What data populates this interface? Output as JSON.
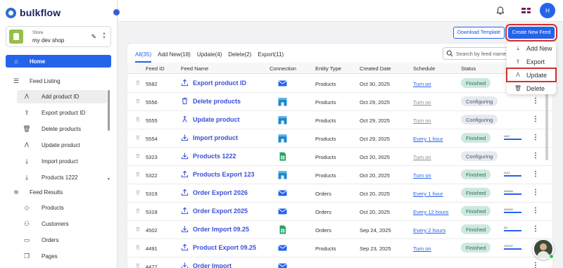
{
  "app": {
    "name": "bulkflow"
  },
  "store": {
    "label": "Store",
    "name": "my dev shop"
  },
  "sidebar": {
    "home": "Home",
    "feed_listing": "Feed Listing",
    "feed_items": [
      {
        "label": "Add product ID",
        "icon": "person-up-icon",
        "active": true
      },
      {
        "label": "Export product ID",
        "icon": "upload-icon"
      },
      {
        "label": "Delete products",
        "icon": "trash-icon"
      },
      {
        "label": "Update product",
        "icon": "person-up-icon"
      },
      {
        "label": "Import product",
        "icon": "download-icon"
      },
      {
        "label": "Products 1222",
        "icon": "download-icon"
      }
    ],
    "feed_results": "Feed Results",
    "result_items": [
      {
        "label": "Products",
        "icon": "tag-icon"
      },
      {
        "label": "Customers",
        "icon": "user-plus-icon"
      },
      {
        "label": "Orders",
        "icon": "inbox-icon"
      },
      {
        "label": "Pages",
        "icon": "pages-icon"
      }
    ]
  },
  "topbar": {
    "avatar_initial": "H"
  },
  "actions": {
    "download_template": "Download Template",
    "create_new_feed": "Create New Feed"
  },
  "tabs": [
    "All(35)",
    "Add New(18)",
    "Update(4)",
    "Delete(2)",
    "Export(11)"
  ],
  "search": {
    "placeholder": "Search by feed name"
  },
  "columns": [
    "Feed ID",
    "Feed Name",
    "Connection",
    "Entity Type",
    "Created Date",
    "Schedule",
    "Status"
  ],
  "rows": [
    {
      "id": "5582",
      "name": "Export product ID",
      "icon": "upload-icon",
      "conn": "email",
      "entity": "Products",
      "date": "Oct 30, 2025",
      "schedule": "Turn on",
      "sched_dim": false,
      "status": "Finished",
      "progress": ""
    },
    {
      "id": "5556",
      "name": "Delete products",
      "icon": "trash-icon",
      "conn": "store",
      "entity": "Products",
      "date": "Oct 29, 2025",
      "schedule": "Turn on",
      "sched_dim": true,
      "status": "Configuring",
      "progress": ""
    },
    {
      "id": "5555",
      "name": "Update product",
      "icon": "person-up-icon",
      "conn": "store",
      "entity": "Products",
      "date": "Oct 29, 2025",
      "schedule": "Turn on",
      "sched_dim": true,
      "status": "Configuring",
      "progress": ""
    },
    {
      "id": "5554",
      "name": "Import product",
      "icon": "download-icon",
      "conn": "store",
      "entity": "Products",
      "date": "Oct 29, 2025",
      "schedule": "Every 1 hour",
      "sched_dim": false,
      "status": "Finished",
      "progress": "16/17"
    },
    {
      "id": "5323",
      "name": "Products 1222",
      "icon": "download-icon",
      "conn": "sheets",
      "entity": "Products",
      "date": "Oct 20, 2025",
      "schedule": "Turn on",
      "sched_dim": true,
      "status": "Configuring",
      "progress": ""
    },
    {
      "id": "5322",
      "name": "Products Export 123",
      "icon": "upload-icon",
      "conn": "store",
      "entity": "Products",
      "date": "Oct 20, 2025",
      "schedule": "Turn on",
      "sched_dim": false,
      "status": "Finished",
      "progress": "11/11"
    },
    {
      "id": "5319",
      "name": "Order Export 2026",
      "icon": "upload-icon",
      "conn": "email",
      "entity": "Orders",
      "date": "Oct 20, 2025",
      "schedule": "Every 1 hour",
      "sched_dim": false,
      "status": "Finished",
      "progress": "444/444"
    },
    {
      "id": "5318",
      "name": "Order Export 2025",
      "icon": "upload-icon",
      "conn": "email",
      "entity": "Orders",
      "date": "Oct 20, 2025",
      "schedule": "Every 12 hours",
      "sched_dim": false,
      "status": "Finished",
      "progress": "444/444"
    },
    {
      "id": "4502",
      "name": "Order Import 09.25",
      "icon": "download-icon",
      "conn": "sheets",
      "entity": "Orders",
      "date": "Sep 24, 2025",
      "schedule": "Every 2 hours",
      "sched_dim": false,
      "status": "Finished",
      "progress": "3/3"
    },
    {
      "id": "4491",
      "name": "Product Export 09.25",
      "icon": "upload-icon",
      "conn": "email",
      "entity": "Products",
      "date": "Sep 23, 2025",
      "schedule": "Turn on",
      "sched_dim": false,
      "status": "Finished",
      "progress": "137/137"
    },
    {
      "id": "4477",
      "name": "Order Import",
      "icon": "download-icon",
      "conn": "email",
      "entity": "",
      "date": "",
      "schedule": "",
      "sched_dim": false,
      "status": "",
      "progress": ""
    }
  ],
  "menu": [
    {
      "label": "Add New",
      "icon": "download-icon"
    },
    {
      "label": "Export",
      "icon": "upload-icon"
    },
    {
      "label": "Update",
      "icon": "person-up-icon"
    },
    {
      "label": "Delete",
      "icon": "trash-icon"
    }
  ],
  "colors": {
    "accent": "#2563eb",
    "highlight": "#d32f2f",
    "finished_bg": "#cde9de",
    "configuring_bg": "#e6eaf0"
  }
}
